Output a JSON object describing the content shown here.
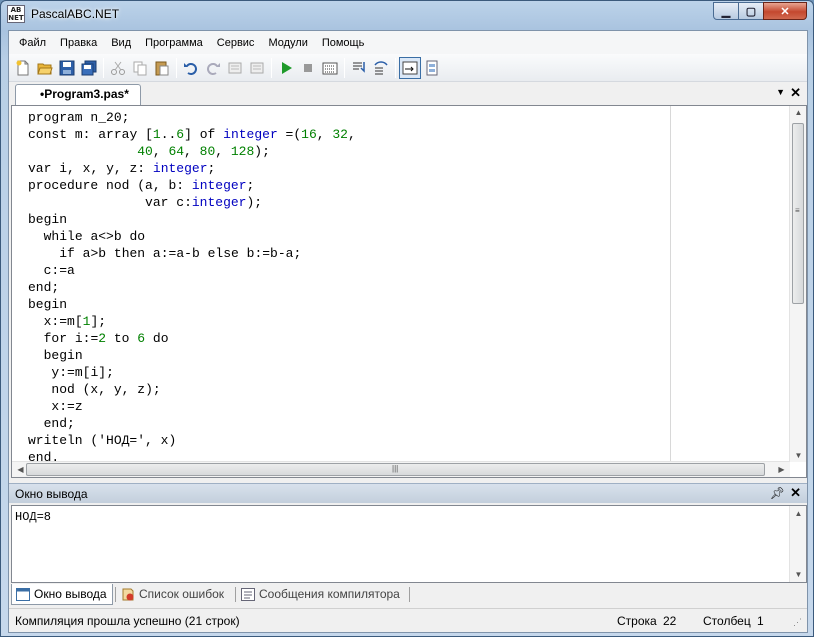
{
  "window": {
    "title": "PascalABC.NET",
    "logo_text": "AB\nNET"
  },
  "menu": [
    "Файл",
    "Правка",
    "Вид",
    "Программа",
    "Сервис",
    "Модули",
    "Помощь"
  ],
  "editor_tab": {
    "label": "•Program3.pas*"
  },
  "code_lines": [
    "program n_20;",
    "const m: array [1..6] of integer =(16, 32,",
    "              40, 64, 80, 128);",
    "var i, x, y, z: integer;",
    "procedure nod (a, b: integer;",
    "               var c:integer);",
    "begin",
    "  while a<>b do",
    "    if a>b then a:=a-b else b:=b-a;",
    "  c:=a",
    "end;",
    "begin",
    "  x:=m[1];",
    "  for i:=2 to 6 do",
    "  begin",
    "   y:=m[i];",
    "   nod (x, y, z);",
    "   x:=z",
    "  end;",
    "writeln ('НОД=', x)",
    "end."
  ],
  "output_panel": {
    "title": "Окно вывода",
    "text": "НОД=8"
  },
  "bottom_tabs": [
    "Окно вывода",
    "Список ошибок",
    "Сообщения компилятора"
  ],
  "status": {
    "message": "Компиляция прошла успешно (21 строк)",
    "row_label": "Строка",
    "row_value": "22",
    "col_label": "Столбец",
    "col_value": "1"
  }
}
